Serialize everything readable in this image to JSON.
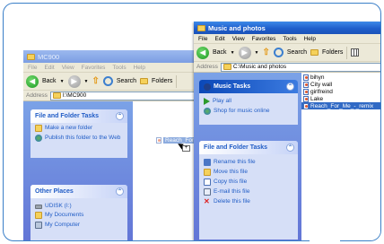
{
  "window_back": {
    "title": "MC900",
    "menu": [
      "File",
      "Edit",
      "View",
      "Favorites",
      "Tools",
      "Help"
    ],
    "toolbar": {
      "back": "Back",
      "search": "Search",
      "folders": "Folders"
    },
    "address_label": "Address",
    "address_value": "I:\\MC900",
    "file_folder_tasks": {
      "heading": "File and Folder Tasks",
      "items": [
        "Make a new folder",
        "Publish this folder to the Web"
      ]
    },
    "other_places": {
      "heading": "Other Places",
      "items": [
        "UDISK (I:)",
        "My Documents",
        "My Computer"
      ]
    }
  },
  "window_front": {
    "title": "Music and photos",
    "menu": [
      "File",
      "Edit",
      "View",
      "Favorites",
      "Tools",
      "Help"
    ],
    "toolbar": {
      "back": "Back",
      "search": "Search",
      "folders": "Folders"
    },
    "address_label": "Address",
    "address_value": "C:\\Music and photos",
    "music_tasks": {
      "heading": "Music Tasks",
      "items": [
        "Play all",
        "Shop for music online"
      ]
    },
    "file_folder_tasks": {
      "heading": "File and Folder Tasks",
      "items": [
        "Rename this file",
        "Move this file",
        "Copy this file",
        "E-mail this file",
        "Delete this file"
      ]
    },
    "files": [
      "bihyn",
      "City wall",
      "girlfreind",
      "Lake",
      "Reach_For_Me_-_remix"
    ],
    "selected_file": "Reach_For_Me_-_remix"
  },
  "drag_ghost_label": "Reach_For_Me_-_remix",
  "colors": {
    "frame_border": "#3a7fc8",
    "titlebar_active": "#1f5fcc",
    "task_pane": "#7ba2e7",
    "selection": "#316ac5"
  }
}
